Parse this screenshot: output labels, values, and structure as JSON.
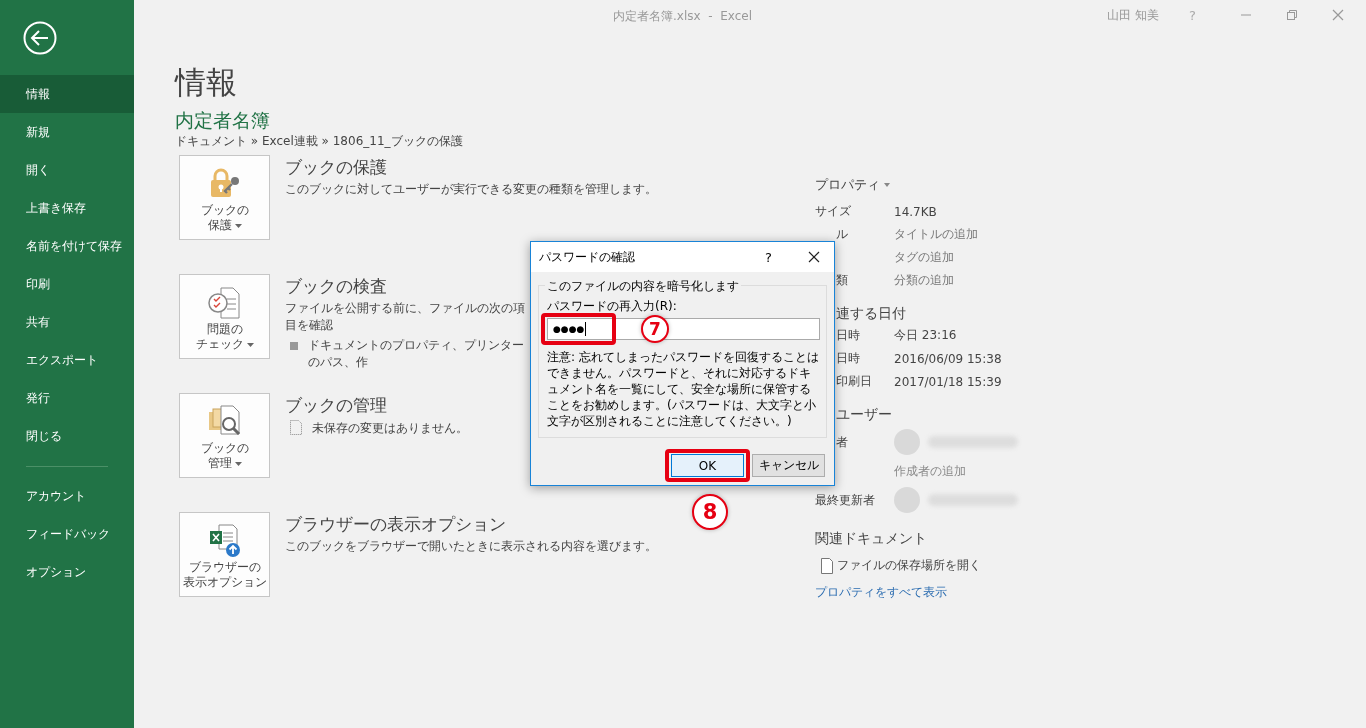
{
  "window": {
    "title": "内定者名簿.xlsx  -  Excel",
    "user": "山田 知美",
    "help": "?"
  },
  "sidebar": {
    "items": [
      {
        "label": "情報",
        "selected": true
      },
      {
        "label": "新規",
        "selected": false
      },
      {
        "label": "開く",
        "selected": false
      },
      {
        "label": "上書き保存",
        "selected": false
      },
      {
        "label": "名前を付けて保存",
        "selected": false
      },
      {
        "label": "印刷",
        "selected": false
      },
      {
        "label": "共有",
        "selected": false
      },
      {
        "label": "エクスポート",
        "selected": false
      },
      {
        "label": "発行",
        "selected": false
      },
      {
        "label": "閉じる",
        "selected": false
      }
    ],
    "footer_items": [
      {
        "label": "アカウント",
        "selected": false
      },
      {
        "label": "フィードバック",
        "selected": false
      },
      {
        "label": "オプション",
        "selected": false
      }
    ]
  },
  "page": {
    "title": "情報",
    "doc_name": "内定者名簿",
    "breadcrumb": "ドキュメント » Excel連載 » 1806_11_ブックの保護"
  },
  "sections": [
    {
      "kind": "protect",
      "button_lines": [
        "ブックの",
        "保護"
      ],
      "dropdown": true,
      "heading": "ブックの保護",
      "description": "このブックに対してユーザーが実行できる変更の種類を管理します。"
    },
    {
      "kind": "inspect",
      "button_lines": [
        "問題の",
        "チェック"
      ],
      "dropdown": true,
      "heading": "ブックの検査",
      "description": "ファイルを公開する前に、ファイルの次の項目を確認",
      "bullet": "ドキュメントのプロパティ、プリンターのパス、作"
    },
    {
      "kind": "manage",
      "button_lines": [
        "ブックの",
        "管理"
      ],
      "dropdown": true,
      "heading": "ブックの管理",
      "note": "未保存の変更はありません。"
    },
    {
      "kind": "browser",
      "button_lines": [
        "ブラウザーの",
        "表示オプション"
      ],
      "dropdown": false,
      "heading": "ブラウザーの表示オプション",
      "description": "このブックをブラウザーで開いたときに表示される内容を選びます。"
    }
  ],
  "properties": {
    "heading": "プロパティ",
    "rows": [
      {
        "label": "サイズ",
        "value": "14.7KB",
        "kind": "plain",
        "partial": false
      },
      {
        "label": "ル",
        "value": "タイトルの追加",
        "kind": "link",
        "partial": true
      },
      {
        "value": "タグの追加",
        "kind": "link"
      },
      {
        "label": "類",
        "value": "分類の追加",
        "kind": "link",
        "partial": true
      }
    ],
    "dates_heading": "連する日付",
    "dates": [
      {
        "label": "日時",
        "value": "今日 23:16"
      },
      {
        "label": "日時",
        "value": "2016/06/09 15:38"
      },
      {
        "label": "印刷日",
        "value": "2017/01/18 15:39"
      }
    ],
    "users_heading": "ユーザー",
    "users": [
      {
        "kind": "person",
        "label": "者",
        "partial": true
      },
      {
        "kind": "add",
        "value": "作成者の追加"
      },
      {
        "kind": "person",
        "label": "最終更新者",
        "partial": false
      }
    ],
    "related_heading": "関連ドキュメント",
    "open_location": "ファイルの保存場所を開く",
    "show_all": "プロパティをすべて表示"
  },
  "dialog": {
    "title": "パスワードの確認",
    "help": "?",
    "group": "このファイルの内容を暗号化します",
    "field_label": "パスワードの再入力(R):",
    "value": "●●●●",
    "note": "注意: 忘れてしまったパスワードを回復することはできません。パスワードと、それに対応するドキュメント名を一覧にして、安全な場所に保管することをお勧めします。(パスワードは、大文字と小文字が区別されることに注意してください。)",
    "buttons": [
      {
        "label": "OK",
        "default": true
      },
      {
        "label": "キャンセル",
        "default": false
      }
    ]
  },
  "annotations": [
    {
      "number": "7",
      "kind": "field"
    },
    {
      "number": "8",
      "kind": "ok"
    }
  ]
}
